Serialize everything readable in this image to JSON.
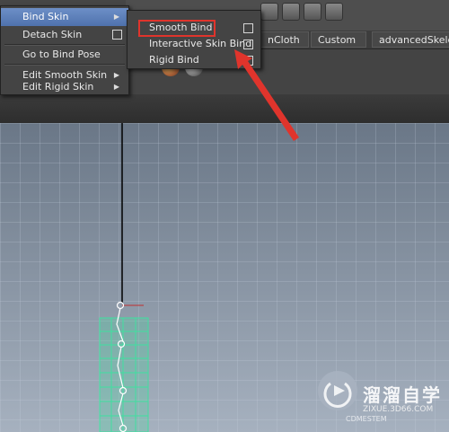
{
  "bind_skin_menu": {
    "items": [
      {
        "label": "Bind Skin",
        "has_submenu": true
      },
      {
        "label": "Detach Skin",
        "has_option_box": true
      },
      {
        "label": "Go to Bind Pose"
      },
      {
        "label": "Edit Smooth Skin",
        "has_submenu": true
      },
      {
        "label": "Edit Rigid Skin",
        "has_submenu": true
      }
    ]
  },
  "bind_skin_submenu": {
    "items": [
      {
        "label": "Smooth Bind",
        "has_option_box": true
      },
      {
        "label": "Interactive Skin Bind",
        "has_option_box": true
      },
      {
        "label": "Rigid Bind",
        "has_option_box": true
      }
    ]
  },
  "shelf_tabs": [
    "nCloth",
    "Custom",
    "advancedSkelete"
  ],
  "watermark": {
    "brand": "溜溜自学",
    "url": "ZIXUE.3D66.COM",
    "tag": "CDMESTEM"
  },
  "colors": {
    "highlight": "#5a7cb8",
    "callout": "#e0342c",
    "rig_mesh": "#3fe0a0",
    "viewport_top": "#6a7787",
    "viewport_bottom": "#a6b1bf"
  },
  "icons": [
    "submenu-arrow-icon",
    "option-box-icon",
    "red-arrow-annotation-icon",
    "joint-icon",
    "watermark-play-icon"
  ]
}
